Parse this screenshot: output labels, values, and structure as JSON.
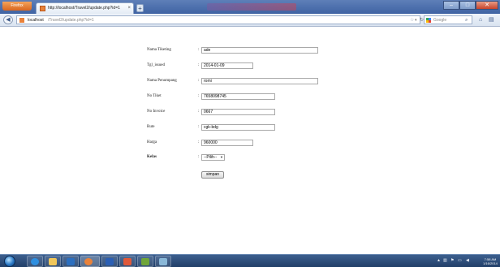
{
  "browser": {
    "menu_button_label": "Firefox",
    "tab_title": "http://localhost/Travel2/update.php?id=1",
    "tab_close": "×",
    "new_tab": "+",
    "url_host": "localhost",
    "url_path": "/Travel2/update.php?id=1",
    "search_engine_label": "Google"
  },
  "form": {
    "fields": [
      {
        "label": "Nama Tiketing",
        "value": "ade"
      },
      {
        "label": "Tgl_issued",
        "value": "2014-01-09"
      },
      {
        "label": "Nama Penumpang",
        "value": "romi"
      },
      {
        "label": "No Tiket",
        "value": "7658098745"
      },
      {
        "label": "No Invoice",
        "value": "0667"
      },
      {
        "label": "Rute",
        "value": "cgk-bdg"
      },
      {
        "label": "Harga",
        "value": "960000"
      }
    ],
    "kelas": {
      "label": "Kelas",
      "selected": "--Pilih--"
    },
    "colon": ":",
    "submit_label": "simpan"
  },
  "taskbar": {
    "time": "7:58 AM",
    "date": "1/16/2014"
  }
}
